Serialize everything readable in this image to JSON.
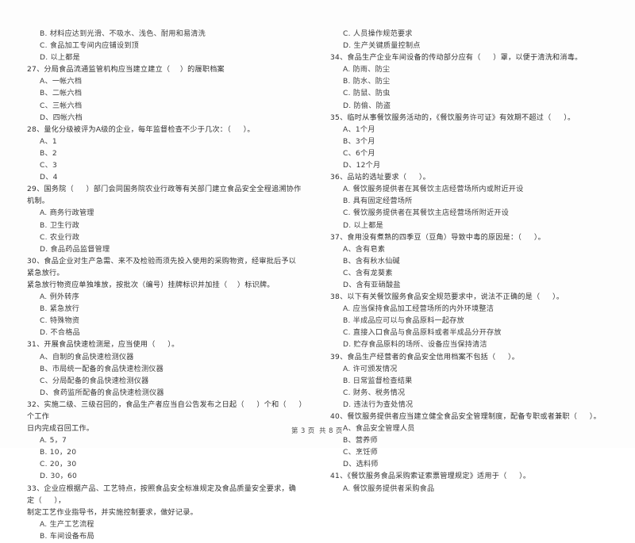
{
  "document": {
    "type": "exam-paper",
    "language": "zh-CN"
  },
  "footer": {
    "prefix": "第",
    "current_page": "3",
    "middle": "页  共",
    "total_pages": "8",
    "suffix": "页",
    "full_text": "第 3 页  共 8 页"
  },
  "left_column": {
    "orphan_options": [
      "B. 材料应达到光滑、不吸水、浅色、耐用和易清洗",
      "C. 食品加工专间内应铺设到顶",
      "D. 以上都是"
    ],
    "questions": [
      {
        "number": "27",
        "stem": "27、分局食品流通监管机构应当建立建立（    ）的履职档案",
        "options": [
          "A、一帐六档",
          "B、二帐六档",
          "C、三帐六档",
          "D、四帐六档"
        ]
      },
      {
        "number": "28",
        "stem": "28、量化分级被评为A级的企业，每年监督检查不少于几次：（     ）。",
        "options": [
          "A、1",
          "B、2",
          "C、3",
          "D、4"
        ]
      },
      {
        "number": "29",
        "stem": "29、国务院（     ）部门会同国务院农业行政等有关部门建立食品安全全程追溯协作机制。",
        "options": [
          "A. 商务行政管理",
          "B. 卫生行政",
          "C. 农业行政",
          "D. 食品药品监督管理"
        ]
      },
      {
        "number": "30",
        "stem": "30、食品企业对生产急需、来不及检验而须先投入使用的采购物资，经审批后予以紧急放行。\n紧急放行物资应单独堆放，按批次（编号）挂牌标识并加挂（    ）标识牌。",
        "options": [
          "A. 例外转序",
          "B. 紧急放行",
          "C. 特殊物资",
          "D. 不合格品"
        ]
      },
      {
        "number": "31",
        "stem": "31、开展食品快速检测是，应当使用（     ）。",
        "options": [
          "A、自制的食品快速检测仪器",
          "B、市局统一配备的食品快速检测仪器",
          "C、分局配备的食品快速检测仪器",
          "D、食药监所配备的食品快速检测仪器"
        ]
      },
      {
        "number": "32",
        "stem": "32、实施二级、三级召回的，食品生产者应当自公告发布之日起（     ）个和（     ）个工作\n日内完成召回工作。",
        "options": [
          "A. 5，7",
          "B. 10，20",
          "C. 20，30",
          "D. 30，60"
        ]
      },
      {
        "number": "33",
        "stem": "33、企业应根据产品、工艺特点，按照食品安全标准规定及食品质量安全要求，确定（     ），\n制定工艺作业指导书，并实施控制要求，做好记录。",
        "options": [
          "A. 生产工艺流程",
          "B. 车间设备布局"
        ]
      }
    ]
  },
  "right_column": {
    "orphan_options": [
      "C. 人员操作规范要求",
      "D. 生产关键质量控制点"
    ],
    "questions": [
      {
        "number": "34",
        "stem": "34、食品生产企业车间设备的传动部分应有（     ）罩，以便于清洗和消毒。",
        "options": [
          "A. 防雨、防尘",
          "B. 防水、防尘",
          "C. 防鼠、防虫",
          "D. 防偷、防盗"
        ]
      },
      {
        "number": "35",
        "stem": "35、临时从事餐饮服务活动的，《餐饮服务许可证》有效期不超过（     ）。",
        "options": [
          "A、1个月",
          "B、3个月",
          "C、6个月",
          "D、12个月"
        ]
      },
      {
        "number": "36",
        "stem": "36、品站的选址要求（     ）。",
        "options": [
          "A. 餐饮服务提供者在其餐饮主店经营场所内或附近开设",
          "B. 具有固定经营场所",
          "C. 餐饮服务提供者在其餐饮主店经营场所附近开设",
          "D. 以上都是"
        ]
      },
      {
        "number": "37",
        "stem": "37、食用没有煮熟的四季豆（豆角）导致中毒的原因是：（     ）。",
        "options": [
          "A、含有皂素",
          "B、含有秋水仙碱",
          "C、含有龙葵素",
          "D、含有亚硝酸盐"
        ]
      },
      {
        "number": "38",
        "stem": "38、以下有关餐饮服务食品安全规范要求中，说法不正确的是（     ）。",
        "options": [
          "A. 应当保持食品加工经营场所的内外环境整洁",
          "B. 半成品应可以与食品原料一起存放",
          "C. 直接入口食品与食品原料或者半成品分开存放",
          "D. 贮存食品原料的场所、设备应当保持清洁"
        ]
      },
      {
        "number": "39",
        "stem": "39、食品生产经营者的食品安全信用档案不包括（     ）。",
        "options": [
          "A. 许可颁发情况",
          "B. 日常监督检查结果",
          "C. 财务、税务情况",
          "D. 违法行为查处情况"
        ]
      },
      {
        "number": "40",
        "stem": "40、餐饮服务提供者应当建立健全食品安全管理制度，配备专职或者兼职（     ）。",
        "options": [
          "A、食品安全管理人员",
          "B、营养师",
          "C、烹饪师",
          "D、选料师"
        ]
      },
      {
        "number": "41",
        "stem": "41、《餐饮服务食品采购索证索票管理规定》适用于（     ）。",
        "options": [
          "A. 餐饮服务提供者采购食品"
        ]
      }
    ]
  }
}
